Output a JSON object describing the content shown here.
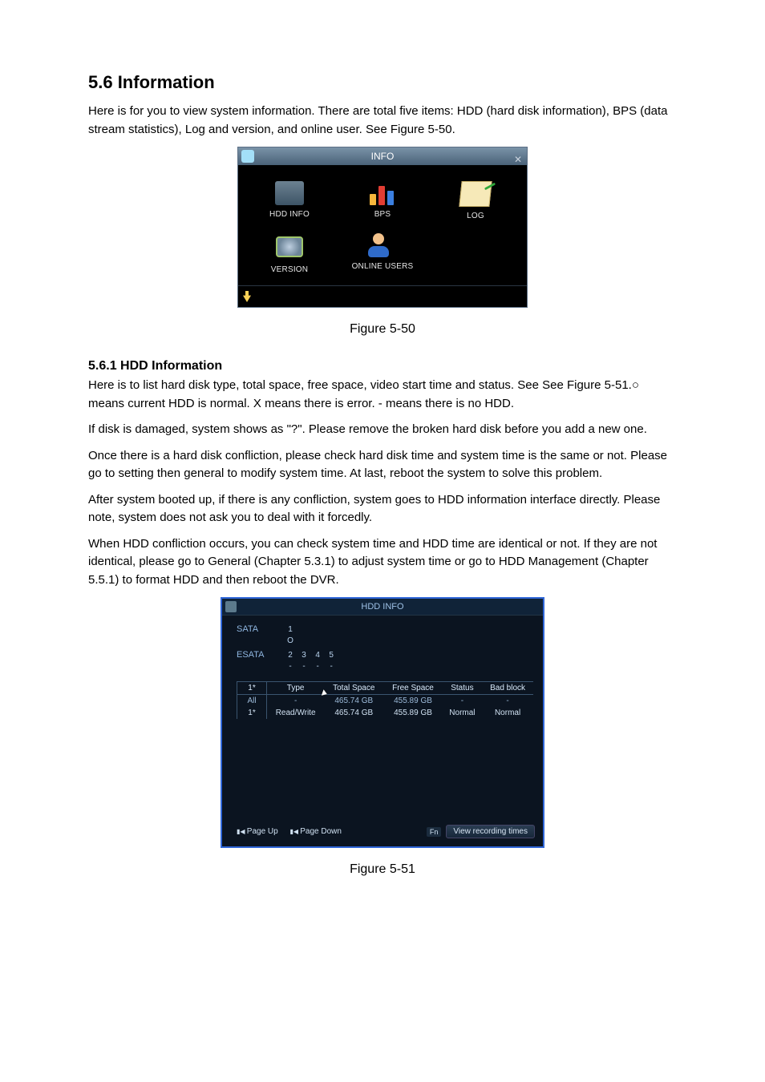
{
  "section": {
    "number_title": "5.6  Information",
    "intro": "Here is for you to view system information. There are total five items: HDD (hard disk information), BPS (data stream statistics), Log and version, and online user. See Figure 5-50."
  },
  "fig1": {
    "caption": "Figure 5-50",
    "title": "INFO",
    "items": {
      "hdd": "HDD INFO",
      "bps": "BPS",
      "log": "LOG",
      "version": "VERSION",
      "online": "ONLINE USERS"
    }
  },
  "subsection": {
    "heading": "5.6.1  HDD Information",
    "p1": "Here is to list hard disk type, total space, free space, video start time and status. See  See Figure 5-51.○ means current HDD is normal. X means there is error. - means there is no HDD.",
    "p2": "If disk is damaged, system shows as \"?\". Please remove the broken hard disk before you add a new one.",
    "p3": "Once there is a hard disk confliction, please check hard disk time and system time is the same or not. Please go to setting then general to modify system time.  At last, reboot the system to solve this problem.",
    "p4": "After system booted up, if there is any confliction, system goes to HDD information interface directly. Please note, system does not ask you to deal with it forcedly.",
    "p5": "When HDD confliction occurs, you can check system time and HDD time are identical or not. If they are not identical, please go to General (Chapter 5.3.1) to adjust system time or go to HDD Management (Chapter 5.5.1) to format HDD and then reboot the DVR."
  },
  "fig2": {
    "caption": "Figure 5-51",
    "title": "HDD INFO",
    "sata_label": "SATA",
    "sata_nums": [
      "1"
    ],
    "sata_marks": [
      "O"
    ],
    "esata_label": "ESATA",
    "esata_nums": [
      "2",
      "3",
      "4",
      "5"
    ],
    "esata_marks": [
      "-",
      "-",
      "-",
      "-"
    ],
    "columns": [
      "1*",
      "Type",
      "Total Space",
      "Free Space",
      "Status",
      "Bad block"
    ],
    "rows": [
      {
        "idx": "All",
        "type": "-",
        "total": "465.74 GB",
        "free": "455.89 GB",
        "status": "-",
        "bad": "-"
      },
      {
        "idx": "1*",
        "type": "Read/Write",
        "total": "465.74 GB",
        "free": "455.89 GB",
        "status": "Normal",
        "bad": "Normal"
      }
    ],
    "footer": {
      "page_up": "Page Up",
      "page_down": "Page Down",
      "fn": "Fn",
      "button": "View recording times"
    }
  }
}
